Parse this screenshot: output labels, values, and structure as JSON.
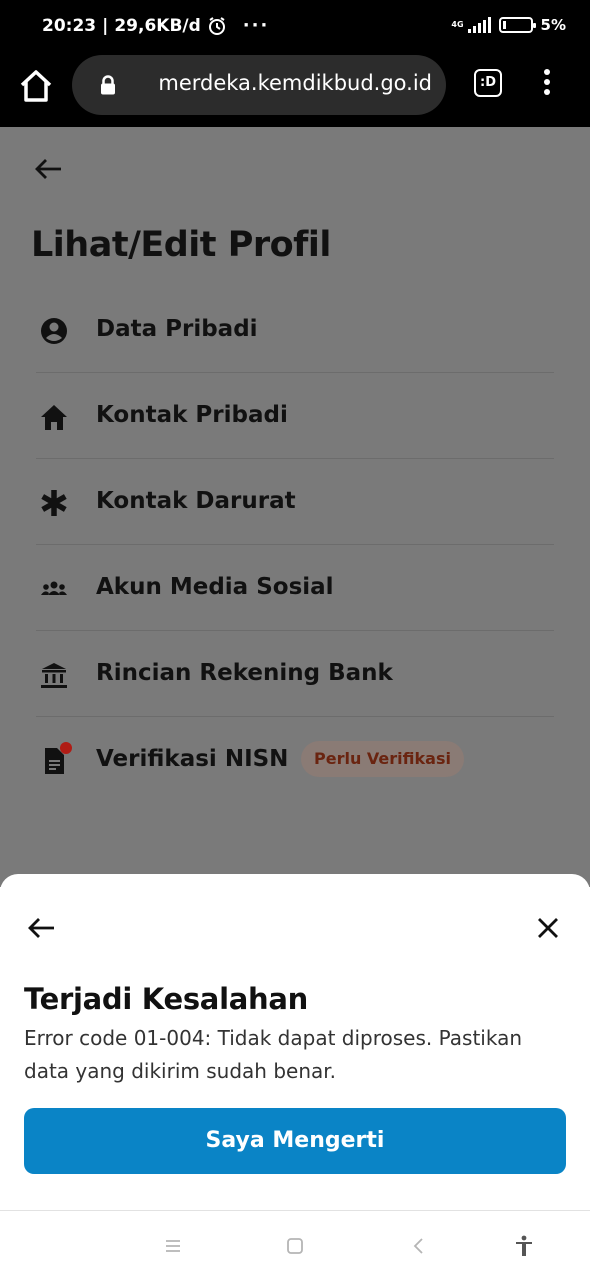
{
  "status_bar": {
    "time": "20:23",
    "net_speed": "29,6KB/d",
    "more_dots": "···",
    "network_type": "4G",
    "battery_percent": "5%"
  },
  "browser": {
    "url": "merdeka.kemdikbud.go.id",
    "tab_label": ":D"
  },
  "page": {
    "title": "Lihat/Edit Profil",
    "items": [
      {
        "label": "Data Pribadi",
        "icon": "account-circle-icon"
      },
      {
        "label": "Kontak Pribadi",
        "icon": "house-icon"
      },
      {
        "label": "Kontak Darurat",
        "icon": "asterisk-icon"
      },
      {
        "label": "Akun Media Sosial",
        "icon": "people-icon"
      },
      {
        "label": "Rincian Rekening Bank",
        "icon": "bank-icon"
      },
      {
        "label": "Verifikasi NISN",
        "icon": "document-icon",
        "badge": "Perlu Verifikasi"
      }
    ]
  },
  "dialog": {
    "title": "Terjadi Kesalahan",
    "message": "Error code 01-004: Tidak dapat diproses. Pastikan data yang dikirim sudah benar.",
    "button_label": "Saya Mengerti"
  },
  "colors": {
    "accent": "#0a84c6",
    "overlay": "#7a7a7a",
    "badge_text": "#6a2410",
    "notification_dot": "#b01c15"
  }
}
